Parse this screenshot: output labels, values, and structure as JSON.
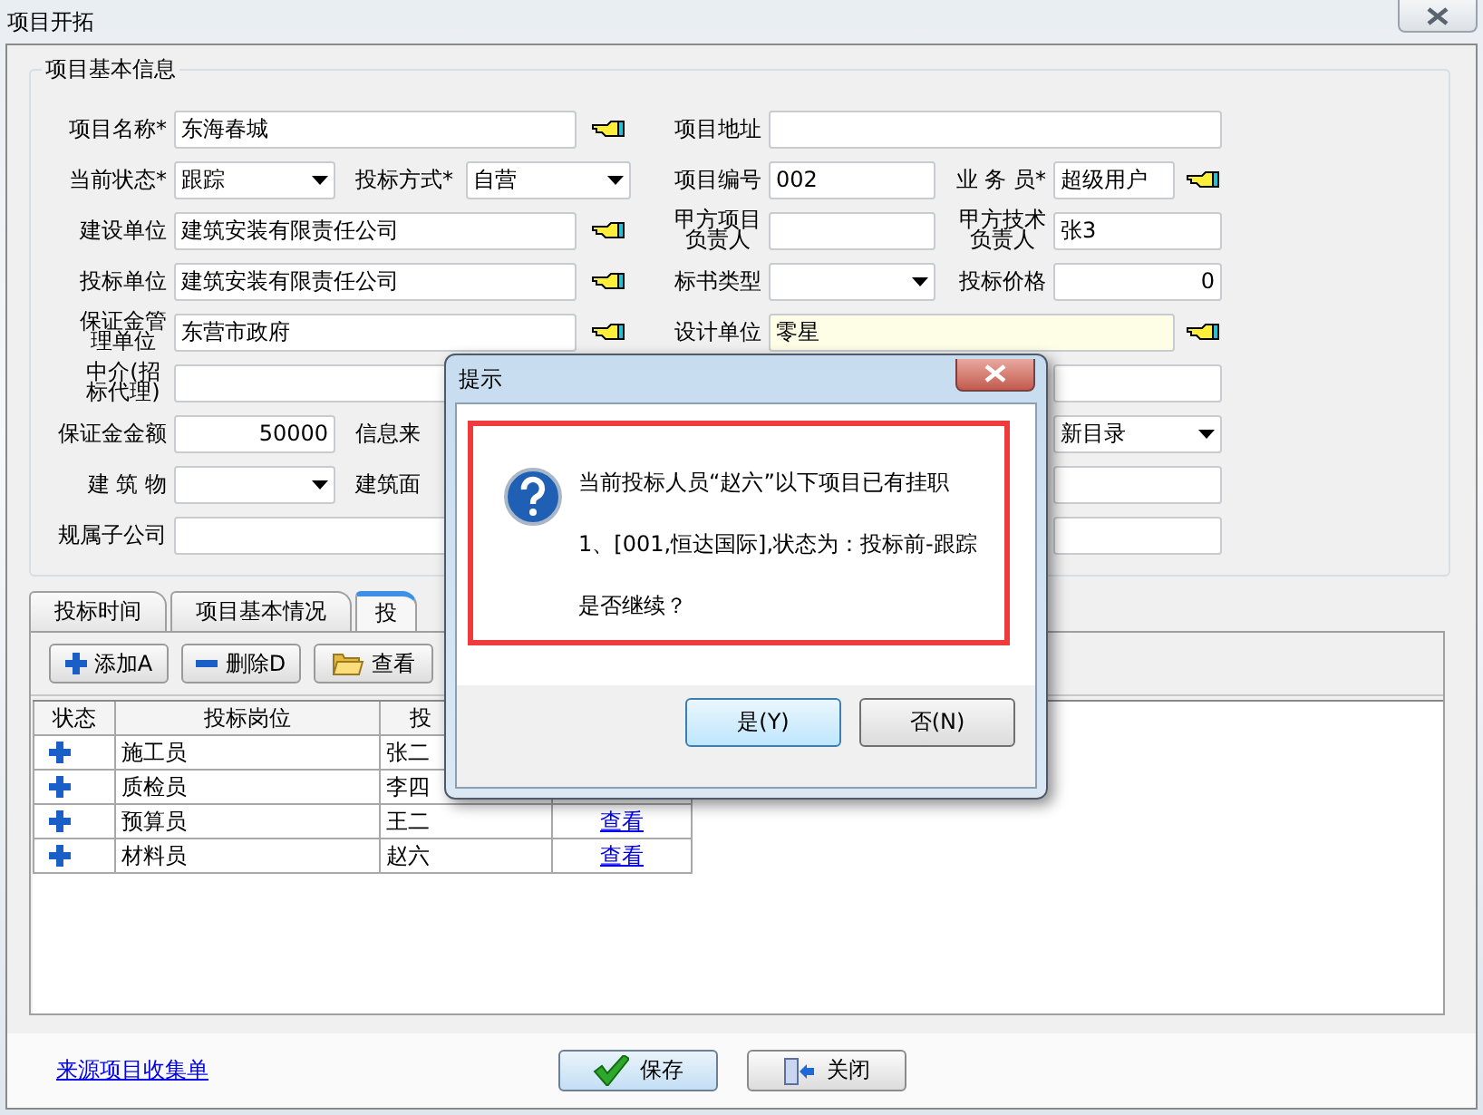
{
  "window": {
    "title": "项目开拓"
  },
  "basic_info": {
    "title": "项目基本信息",
    "fields": [
      {
        "label": "项目名称*",
        "control": {
          "kind": "lookup",
          "value": "东海春城",
          "highlighted": false
        }
      },
      {
        "label": "项目地址",
        "control": {
          "kind": "input",
          "highlighted": false
        }
      },
      {
        "label": "当前状态*",
        "control": {
          "kind": "dropdown",
          "value": "跟踪"
        }
      },
      {
        "label": "投标方式*",
        "control": {
          "kind": "dropdown",
          "value": "自营"
        }
      },
      {
        "label": "项目编号",
        "control": {
          "kind": "input",
          "value": "002",
          "highlighted": false
        }
      },
      {
        "label": "业 务 员*",
        "control": {
          "kind": "lookup",
          "value": "超级用户",
          "highlighted": false
        }
      },
      {
        "label": "建设单位",
        "control": {
          "kind": "lookup",
          "value": "建筑安装有限责任公司",
          "highlighted": false
        }
      },
      {
        "label": "甲方项目负责人",
        "control": {
          "kind": "input",
          "highlighted": false
        }
      },
      {
        "label": "甲方技术负责人",
        "control": {
          "kind": "input",
          "value": "张3",
          "highlighted": false
        }
      },
      {
        "label": "投标单位",
        "control": {
          "kind": "lookup",
          "value": "建筑安装有限责任公司",
          "highlighted": false
        }
      },
      {
        "label": "标书类型",
        "control": {
          "kind": "dropdown"
        }
      },
      {
        "label": "投标价格",
        "control": {
          "kind": "number",
          "value": "0",
          "highlighted": false
        }
      },
      {
        "label": "保证金管理单位",
        "control": {
          "kind": "lookup",
          "value": "东营市政府",
          "highlighted": false
        }
      },
      {
        "label": "设计单位",
        "control": {
          "kind": "lookup",
          "value": "零星",
          "highlighted": true
        }
      },
      {
        "label": "中介(招标代理)",
        "control": {
          "kind": "input",
          "highlighted": false
        }
      },
      {
        "control": {
          "kind": "input",
          "highlighted": false
        }
      },
      {
        "label": "保证金金额",
        "control": {
          "kind": "number",
          "value": "50000",
          "highlighted": false
        }
      },
      {
        "label": "信息来"
      },
      {
        "control": {
          "kind": "dropdown",
          "value": "新目录"
        }
      },
      {
        "label": "建 筑 物",
        "control": {
          "kind": "dropdown"
        }
      },
      {
        "label": "建筑面"
      },
      {
        "control": {
          "kind": "input",
          "highlighted": false
        }
      },
      {
        "label": "规属子公司",
        "control": {
          "kind": "input",
          "highlighted": false
        }
      },
      {
        "control": {
          "kind": "input",
          "highlighted": false
        }
      }
    ]
  },
  "tabs": [
    {
      "label": "投标时间",
      "selected": false
    },
    {
      "label": "项目基本情况",
      "selected": false
    },
    {
      "label": "投",
      "selected": true
    }
  ],
  "toolbar": [
    {
      "kind": "add",
      "label": "添加A"
    },
    {
      "kind": "remove",
      "label": "删除D"
    },
    {
      "kind": "open",
      "label": "查看"
    }
  ],
  "table": {
    "columns": [
      "状态",
      "投标岗位",
      "投"
    ],
    "rows": [
      {
        "position": "施工员",
        "person": "张二"
      },
      {
        "position": "质检员",
        "person": "李四"
      },
      {
        "position": "预算员",
        "person": "王二",
        "link": "查看"
      },
      {
        "position": "材料员",
        "person": "赵六",
        "link": "查看"
      }
    ]
  },
  "footer": {
    "link": "来源项目收集单",
    "buttons": [
      {
        "kind": "save",
        "label": "保存"
      },
      {
        "kind": "close",
        "label": "关闭"
      }
    ]
  },
  "dialog": {
    "title": "提示",
    "lines": [
      "当前投标人员“赵六”以下项目已有挂职",
      "1、[001,恒达国际],状态为：投标前-跟踪",
      "是否继续？"
    ],
    "buttons": [
      {
        "label": "是(Y)",
        "selected": true
      },
      {
        "label": "否(N)",
        "selected": false
      }
    ]
  }
}
